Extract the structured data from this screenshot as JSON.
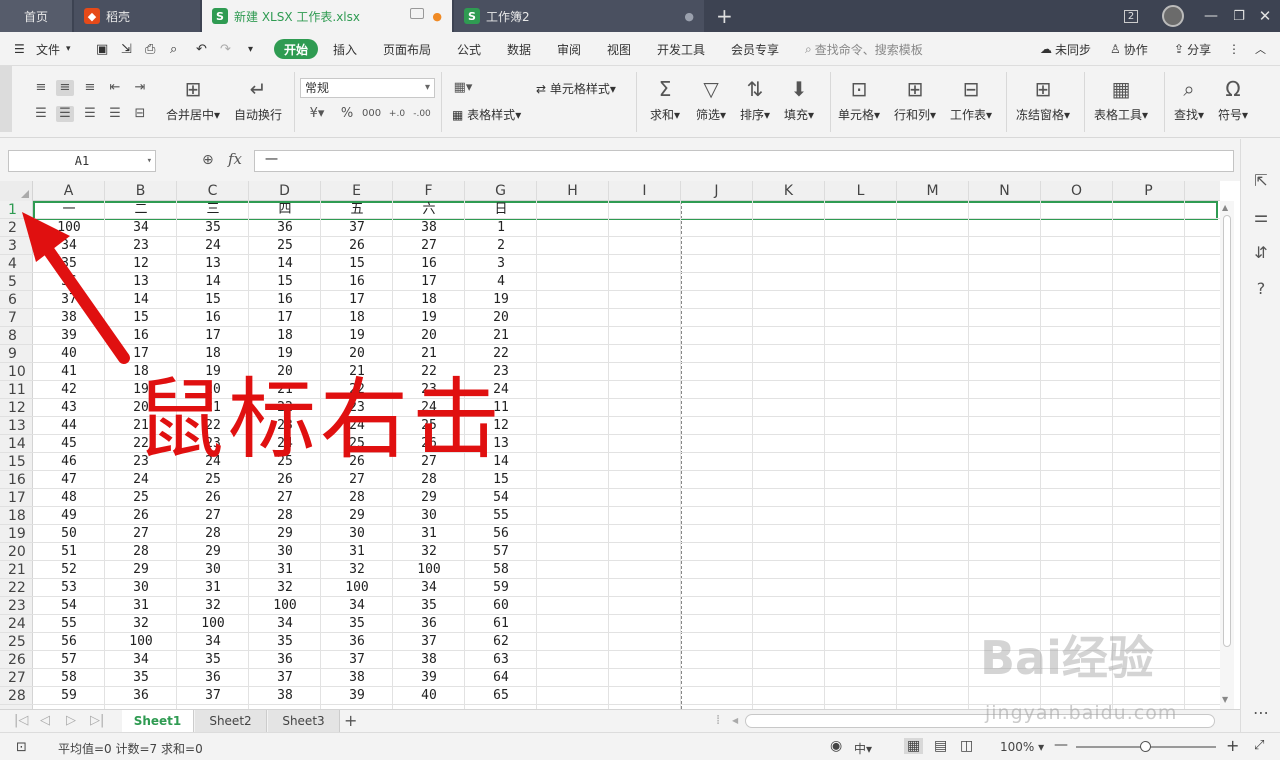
{
  "titlebar": {
    "tabs": [
      {
        "label": "首页"
      },
      {
        "label": "稻壳"
      },
      {
        "label": "新建 XLSX 工作表.xlsx"
      },
      {
        "label": "工作簿2"
      }
    ],
    "window_badge": "2"
  },
  "menu": {
    "file": "文件",
    "items": [
      "开始",
      "插入",
      "页面布局",
      "公式",
      "数据",
      "审阅",
      "视图",
      "开发工具",
      "会员专享"
    ],
    "search_placeholder": "查找命令、搜索模板",
    "right": [
      "未同步",
      "协作",
      "分享"
    ]
  },
  "ribbon": {
    "merge": "合并居中",
    "wrap": "自动换行",
    "number_format": "常规",
    "currency": "¥",
    "percent": "%",
    "thousands": "000",
    "cell_style": "单元格样式",
    "table_style": "表格样式",
    "sum": "求和",
    "filter": "筛选",
    "sort": "排序",
    "fill": "填充",
    "cell": "单元格",
    "rowcol": "行和列",
    "sheet": "工作表",
    "freeze": "冻结窗格",
    "table_tools": "表格工具",
    "find": "查找",
    "symbol": "符号"
  },
  "formula_bar": {
    "name_box": "A1",
    "fx": "fx",
    "content": "一"
  },
  "columns": [
    "A",
    "B",
    "C",
    "D",
    "E",
    "F",
    "G",
    "H",
    "I",
    "J",
    "K",
    "L",
    "M",
    "N",
    "O",
    "P"
  ],
  "rows": [
    [
      "一",
      "二",
      "三",
      "四",
      "五",
      "六",
      "日"
    ],
    [
      "100",
      "34",
      "35",
      "36",
      "37",
      "38",
      "1"
    ],
    [
      "34",
      "23",
      "24",
      "25",
      "26",
      "27",
      "2"
    ],
    [
      "35",
      "12",
      "13",
      "14",
      "15",
      "16",
      "3"
    ],
    [
      "36",
      "13",
      "14",
      "15",
      "16",
      "17",
      "4"
    ],
    [
      "37",
      "14",
      "15",
      "16",
      "17",
      "18",
      "19"
    ],
    [
      "38",
      "15",
      "16",
      "17",
      "18",
      "19",
      "20"
    ],
    [
      "39",
      "16",
      "17",
      "18",
      "19",
      "20",
      "21"
    ],
    [
      "40",
      "17",
      "18",
      "19",
      "20",
      "21",
      "22"
    ],
    [
      "41",
      "18",
      "19",
      "20",
      "21",
      "22",
      "23"
    ],
    [
      "42",
      "19",
      "20",
      "21",
      "22",
      "23",
      "24"
    ],
    [
      "43",
      "20",
      "21",
      "22",
      "23",
      "24",
      "11"
    ],
    [
      "44",
      "21",
      "22",
      "23",
      "24",
      "25",
      "12"
    ],
    [
      "45",
      "22",
      "23",
      "24",
      "25",
      "26",
      "13"
    ],
    [
      "46",
      "23",
      "24",
      "25",
      "26",
      "27",
      "14"
    ],
    [
      "47",
      "24",
      "25",
      "26",
      "27",
      "28",
      "15"
    ],
    [
      "48",
      "25",
      "26",
      "27",
      "28",
      "29",
      "54"
    ],
    [
      "49",
      "26",
      "27",
      "28",
      "29",
      "30",
      "55"
    ],
    [
      "50",
      "27",
      "28",
      "29",
      "30",
      "31",
      "56"
    ],
    [
      "51",
      "28",
      "29",
      "30",
      "31",
      "32",
      "57"
    ],
    [
      "52",
      "29",
      "30",
      "31",
      "32",
      "100",
      "58"
    ],
    [
      "53",
      "30",
      "31",
      "32",
      "100",
      "34",
      "59"
    ],
    [
      "54",
      "31",
      "32",
      "100",
      "34",
      "35",
      "60"
    ],
    [
      "55",
      "32",
      "100",
      "34",
      "35",
      "36",
      "61"
    ],
    [
      "56",
      "100",
      "34",
      "35",
      "36",
      "37",
      "62"
    ],
    [
      "57",
      "34",
      "35",
      "36",
      "37",
      "38",
      "63"
    ],
    [
      "58",
      "35",
      "36",
      "37",
      "38",
      "39",
      "64"
    ],
    [
      "59",
      "36",
      "37",
      "38",
      "39",
      "40",
      "65"
    ]
  ],
  "sheets": [
    "Sheet1",
    "Sheet2",
    "Sheet3"
  ],
  "status": {
    "stats": "平均值=0  计数=7  求和=0",
    "zoom": "100%"
  },
  "annotation": {
    "text": "鼠标右击",
    "color": "#e01010"
  },
  "watermark": {
    "brand": "Bai经验",
    "url": "jingyan.baidu.com"
  },
  "colors": {
    "accent": "#2f9b52",
    "titlebar": "#3d4352"
  }
}
